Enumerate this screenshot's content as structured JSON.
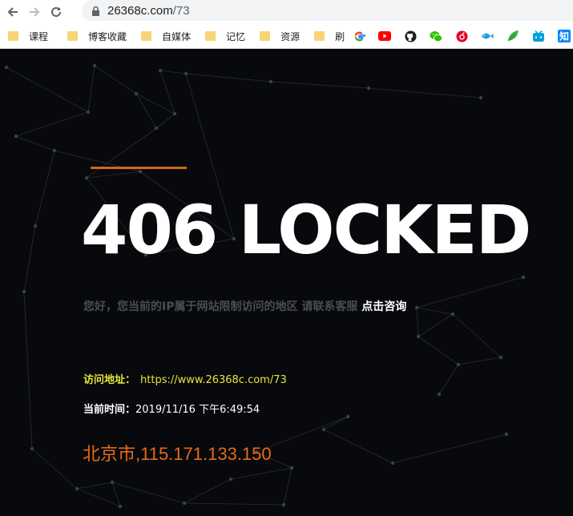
{
  "browser": {
    "url_domain": "26368c.com",
    "url_path": "/73",
    "bookmarks": [
      {
        "label": "课程"
      },
      {
        "label": "博客收藏"
      },
      {
        "label": "自媒体"
      },
      {
        "label": "记忆"
      },
      {
        "label": "资源"
      },
      {
        "label": "刷"
      }
    ],
    "shortcut_icons": [
      "google-icon",
      "youtube-icon",
      "github-icon",
      "wechat-icon",
      "netease-music-icon",
      "fish-icon",
      "leaf-icon",
      "bilibili-icon",
      "zhihu-icon",
      "baidu-icon"
    ],
    "zhihu_char": "知"
  },
  "page": {
    "headline": "406 LOCKED",
    "message": "您好，您当前的IP属于网站限制访问的地区 请联系客服 ",
    "consult_link": "点击咨询",
    "visit_label": "访问地址：",
    "visit_url": "https://www.26368c.com/73",
    "time_label": "当前时间：",
    "time_value": "2019/11/16 下午6:49:54",
    "location": "北京市,115.171.133.150"
  },
  "colors": {
    "background": "#07090c",
    "accent": "#cf6a16",
    "url_yellow": "#e8e43a",
    "location_orange": "#e86a16"
  }
}
